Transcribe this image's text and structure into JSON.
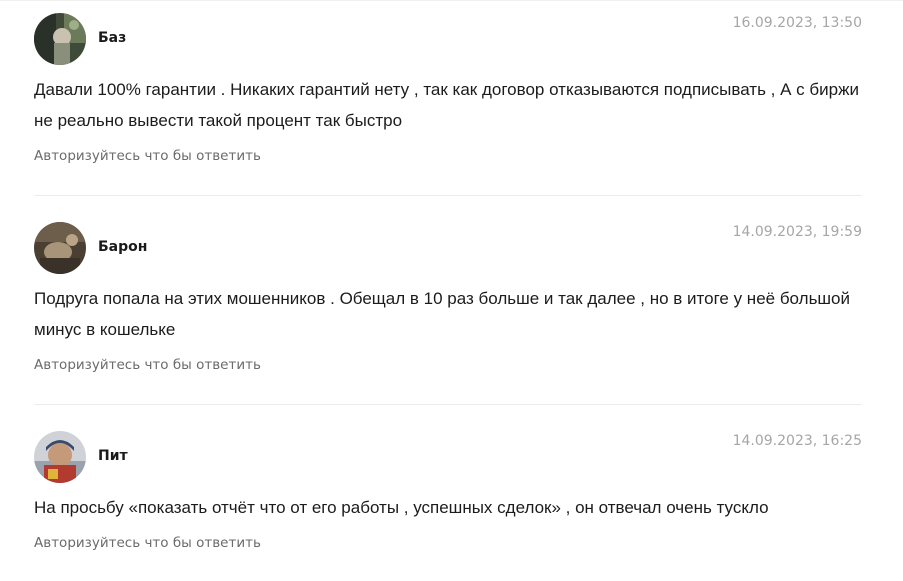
{
  "comments": [
    {
      "author": "Баз",
      "date": "16.09.2023, 13:50",
      "text": "Давали 100% гарантии . Никаких гарантий нету , так как договор отказываются подписывать , А с биржи не реально вывести такой процент так быстро",
      "reply_label": "Авторизуйтесь что бы ответить"
    },
    {
      "author": "Барон",
      "date": "14.09.2023, 19:59",
      "text": "Подруга попала на этих мошенников . Обещал в 10 раз больше и так далее , но в итоге у неё большой минус в кошельке",
      "reply_label": "Авторизуйтесь что бы ответить"
    },
    {
      "author": "Пит",
      "date": "14.09.2023, 16:25",
      "text": "На просьбу «показать отчёт что от его работы , успешных сделок» , он отвечал очень тускло",
      "reply_label": "Авторизуйтесь что бы ответить"
    }
  ]
}
